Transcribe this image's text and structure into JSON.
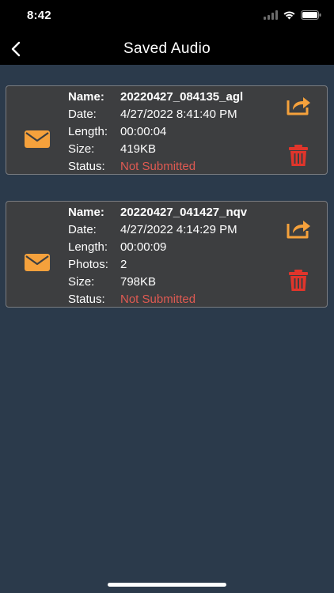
{
  "status_bar": {
    "time": "8:42"
  },
  "header": {
    "title": "Saved Audio"
  },
  "colors": {
    "accent": "#f5a13c",
    "danger": "#e0352b",
    "status_text": "#e05a52",
    "background": "#2b3a4b",
    "card": "#3d3e40"
  },
  "recordings": [
    {
      "name_label": "Name:",
      "name_value": "20220427_084135_agl",
      "date_label": "Date:",
      "date_value": "4/27/2022 8:41:40 PM",
      "length_label": "Length:",
      "length_value": "00:00:04",
      "size_label": "Size:",
      "size_value": "419KB",
      "status_label": "Status:",
      "status_value": "Not Submitted"
    },
    {
      "name_label": "Name:",
      "name_value": "20220427_041427_nqv",
      "date_label": "Date:",
      "date_value": "4/27/2022 4:14:29 PM",
      "length_label": "Length:",
      "length_value": "00:00:09",
      "photos_label": "Photos:",
      "photos_value": "2",
      "size_label": "Size:",
      "size_value": "798KB",
      "status_label": "Status:",
      "status_value": "Not Submitted"
    }
  ]
}
